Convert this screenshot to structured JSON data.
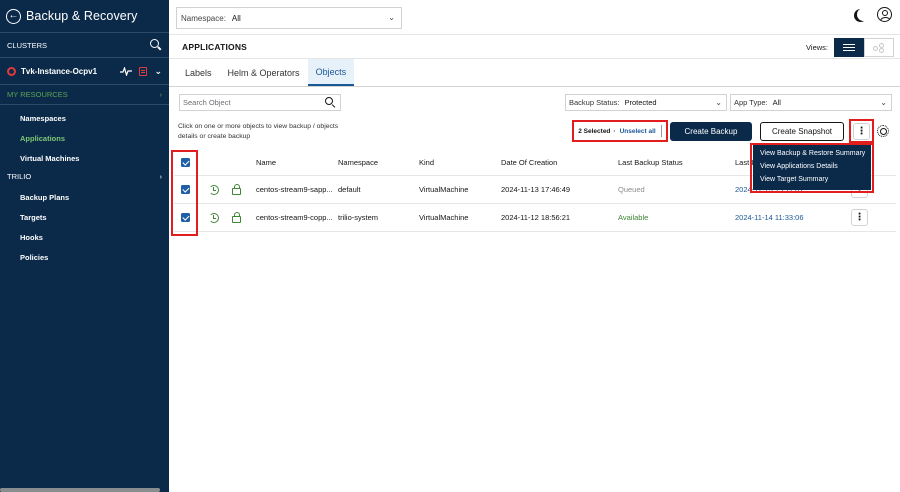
{
  "sidebar": {
    "title": "Backup & Recovery",
    "clusters_label": "CLUSTERS",
    "cluster_name": "Tvk-Instance-Ocpv1",
    "my_resources": "MY RESOURCES",
    "resources": [
      {
        "label": "Namespaces",
        "active": false
      },
      {
        "label": "Applications",
        "active": true
      },
      {
        "label": "Virtual Machines",
        "active": false
      }
    ],
    "trilio_label": "TRILIO",
    "trilio_items": [
      "Backup Plans",
      "Targets",
      "Hooks",
      "Policies"
    ]
  },
  "topbar": {
    "namespace_label": "Namespace:",
    "namespace_value": "All"
  },
  "apps": {
    "title": "APPLICATIONS",
    "views_label": "Views:"
  },
  "tabs": [
    "Labels",
    "Helm & Operators",
    "Objects"
  ],
  "active_tab": "Objects",
  "filters": {
    "search_placeholder": "Search Object",
    "backup_status_label": "Backup Status:",
    "backup_status_value": "Protected",
    "app_type_label": "App Type:",
    "app_type_value": "All"
  },
  "actions": {
    "hint": "Click on one or more objects to view backup / objects details or create backup",
    "selected": "2 Selected",
    "unselect": "Unselect all",
    "create_backup": "Create Backup",
    "create_snapshot": "Create Snapshot"
  },
  "menu": {
    "items": [
      "View Backup & Restore Summary",
      "View Applications Details",
      "View Target Summary"
    ]
  },
  "table": {
    "columns": [
      "Name",
      "Namespace",
      "Kind",
      "Date Of Creation",
      "Last Backup Status",
      "Last I"
    ],
    "rows": [
      {
        "name": "centos-stream9-sapp...",
        "namespace": "default",
        "kind": "VirtualMachine",
        "created": "2024-11-13 17:46:49",
        "status": "Queued",
        "last_backup": "2024-11-13 19:11:01"
      },
      {
        "name": "centos-stream9-copp...",
        "namespace": "trilio-system",
        "kind": "VirtualMachine",
        "created": "2024-11-12 18:56:21",
        "status": "Available",
        "last_backup": "2024-11-14 11:33:06"
      }
    ]
  },
  "colors": {
    "sidebar_bg": "#0b2a4a",
    "primary": "#0b2a4a",
    "link": "#1a5796",
    "success": "#3e8635",
    "highlight": "#e11d1d"
  }
}
